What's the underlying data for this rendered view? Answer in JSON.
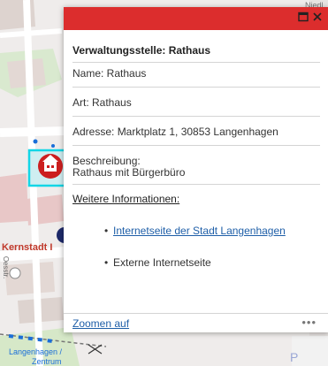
{
  "map": {
    "labels": {
      "top_right_street": "Niedl",
      "district": "Kernstadt I",
      "street_vertical": "Oesstr.",
      "station_line1": "Langenhagen /",
      "station_line2": "Zentrum",
      "poi_letter": "P"
    },
    "colors": {
      "building": "#e7d7d3",
      "road": "#ffffff",
      "park": "#cfe6c1",
      "highlight": "#13d6e6",
      "marker": "#cc1f1f",
      "rail": "#1a6ed8"
    }
  },
  "popup": {
    "accent_color": "#dc2d2d",
    "maximize_icon": "window-maximize-icon",
    "close_icon": "close-icon",
    "title": "Verwaltungsstelle: Rathaus",
    "name_line": "Name: Rathaus",
    "art_line": "Art: Rathaus",
    "address_line": "Adresse: Marktplatz 1, 30853 Langenhagen",
    "description_label": "Beschreibung:",
    "description_value": "Rathaus mit Bürgerbüro",
    "more_info_label": "Weitere Informationen:",
    "links": [
      {
        "label": "Internetseite der Stadt Langenhagen",
        "is_link": true
      },
      {
        "label": "Externe Internetseite",
        "is_link": false
      }
    ],
    "zoom_label": "Zoomen auf",
    "more_actions": "•••"
  }
}
